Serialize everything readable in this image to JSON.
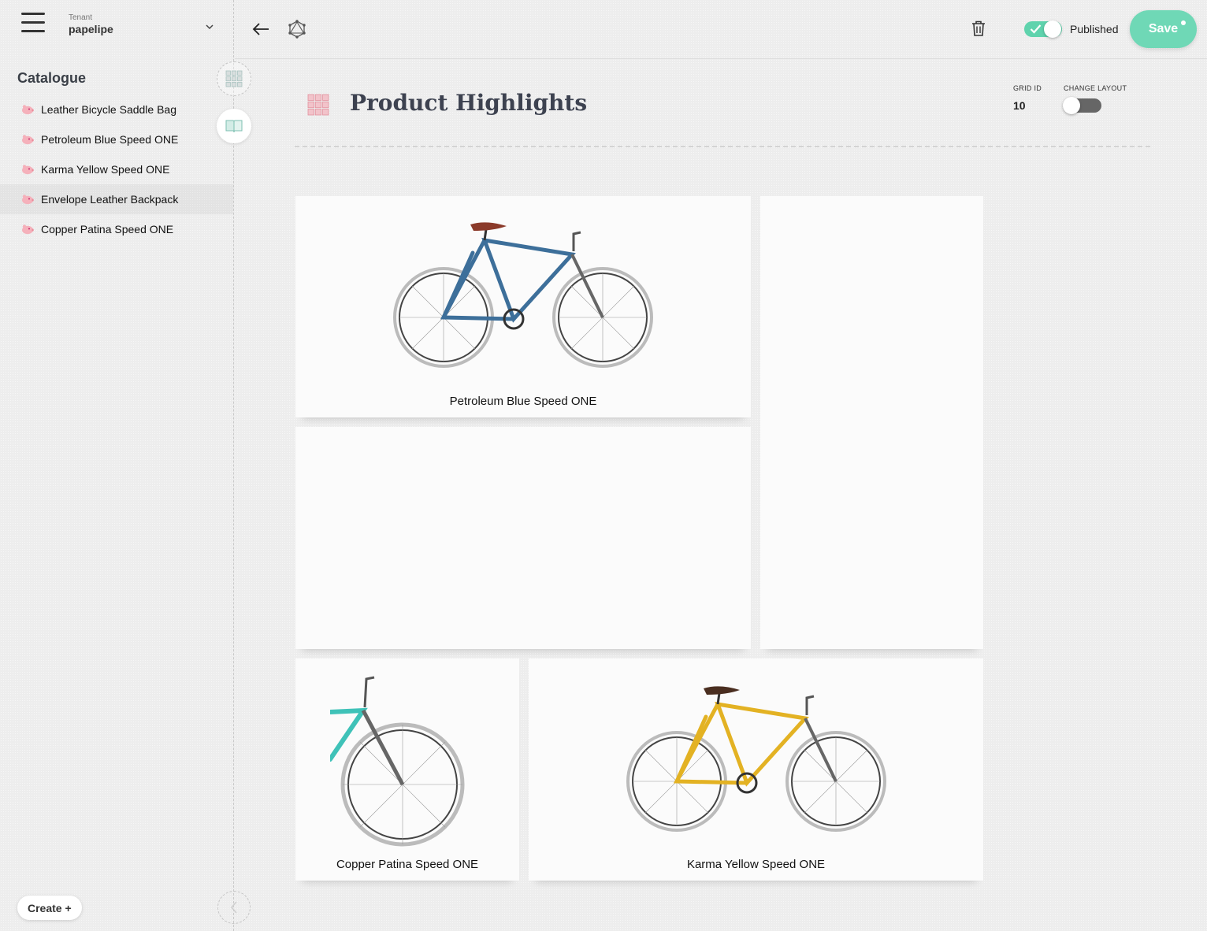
{
  "sidebar": {
    "tenant_caption": "Tenant",
    "tenant_name": "papelipe",
    "section_title": "Catalogue",
    "items": [
      {
        "label": "Leather Bicycle Saddle Bag",
        "icon": "piggy-bank-icon"
      },
      {
        "label": "Petroleum Blue Speed ONE",
        "icon": "piggy-bank-icon"
      },
      {
        "label": "Karma Yellow Speed ONE",
        "icon": "piggy-bank-icon"
      },
      {
        "label": "Envelope Leather Backpack",
        "icon": "piggy-bank-icon"
      },
      {
        "label": "Copper Patina Speed ONE",
        "icon": "piggy-bank-icon"
      }
    ],
    "create_label": "Create +"
  },
  "toolbar": {
    "published_label": "Published",
    "published": true,
    "save_label": "Save",
    "accent_color": "#6fd8b6"
  },
  "page": {
    "title": "Product Highlights",
    "grid_id_label": "GRID ID",
    "grid_id_value": "10",
    "change_layout_label": "CHANGE LAYOUT",
    "change_layout_on": false
  },
  "tiles": [
    {
      "caption": "Petroleum Blue Speed ONE",
      "frame_color": "#3d6f9a"
    },
    {
      "caption": ""
    },
    {
      "caption": ""
    },
    {
      "caption": "Copper Patina Speed ONE",
      "frame_color": "#3fc2b8"
    },
    {
      "caption": "Karma Yellow Speed ONE",
      "frame_color": "#e3b223"
    }
  ]
}
